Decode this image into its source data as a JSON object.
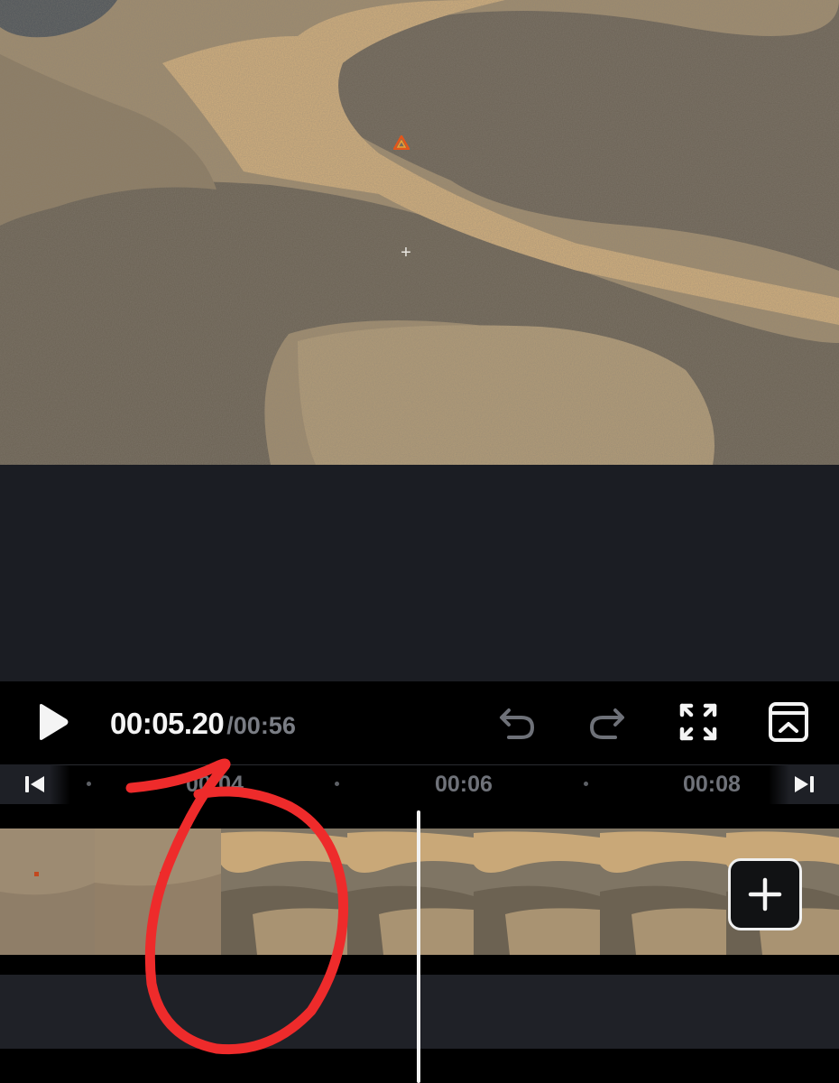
{
  "player": {
    "current_time": "00:05.20",
    "total_time": "/00:56"
  },
  "ruler": {
    "labels": [
      "00:04",
      "00:06",
      "00:08"
    ]
  },
  "icons": {
    "play": "play-icon",
    "undo": "undo-icon",
    "redo": "redo-icon",
    "fullscreen": "fullscreen-icon",
    "keyframe": "keyframe-panel-icon",
    "skip_start": "skip-to-start-icon",
    "skip_end": "skip-to-end-icon",
    "add": "plus-icon"
  },
  "colors": {
    "background": "#1b1d23",
    "bar": "#000000",
    "text_primary": "#f4f4f4",
    "text_muted": "#7a7d84",
    "annotation_red": "#ee2b2b",
    "marker_orange": "#e2561b"
  }
}
